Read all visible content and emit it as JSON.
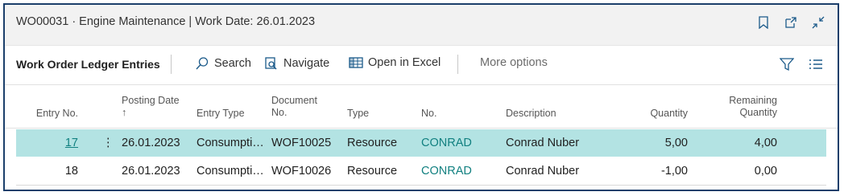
{
  "window": {
    "title": "WO00031 · Engine Maintenance | Work Date: 26.01.2023"
  },
  "actionbar": {
    "title": "Work Order Ledger Entries",
    "search": "Search",
    "navigate": "Navigate",
    "open_excel": "Open in Excel",
    "more": "More options"
  },
  "icons": {
    "bookmark": "bookmark-icon",
    "open_new": "open-in-new-window-icon",
    "collapse": "collapse-icon",
    "search": "search-icon",
    "navigate": "navigate-icon",
    "excel": "excel-icon",
    "filter": "filter-icon",
    "list": "list-view-icon"
  },
  "columns": {
    "entry_no": "Entry No.",
    "posting_date": "Posting Date",
    "posting_date_sort": "↑",
    "entry_type": "Entry Type",
    "document_no_1": "Document",
    "document_no_2": "No.",
    "type": "Type",
    "no": "No.",
    "description": "Description",
    "quantity": "Quantity",
    "remaining_1": "Remaining",
    "remaining_2": "Quantity"
  },
  "rows": [
    {
      "entry_no": "17",
      "menu": "⋮",
      "posting_date": "26.01.2023",
      "entry_type": "Consumpti…",
      "document_no": "WOF10025",
      "type": "Resource",
      "no": "CONRAD",
      "description": "Conrad Nuber",
      "quantity": "5,00",
      "remaining_quantity": "4,00"
    },
    {
      "entry_no": "18",
      "posting_date": "26.01.2023",
      "entry_type": "Consumpti…",
      "document_no": "WOF10026",
      "type": "Resource",
      "no": "CONRAD",
      "description": "Conrad Nuber",
      "quantity": "-1,00",
      "remaining_quantity": "0,00"
    }
  ],
  "colors": {
    "accent": "#118080",
    "selected_row": "#b3e3e3",
    "frame": "#1b3f6b"
  }
}
